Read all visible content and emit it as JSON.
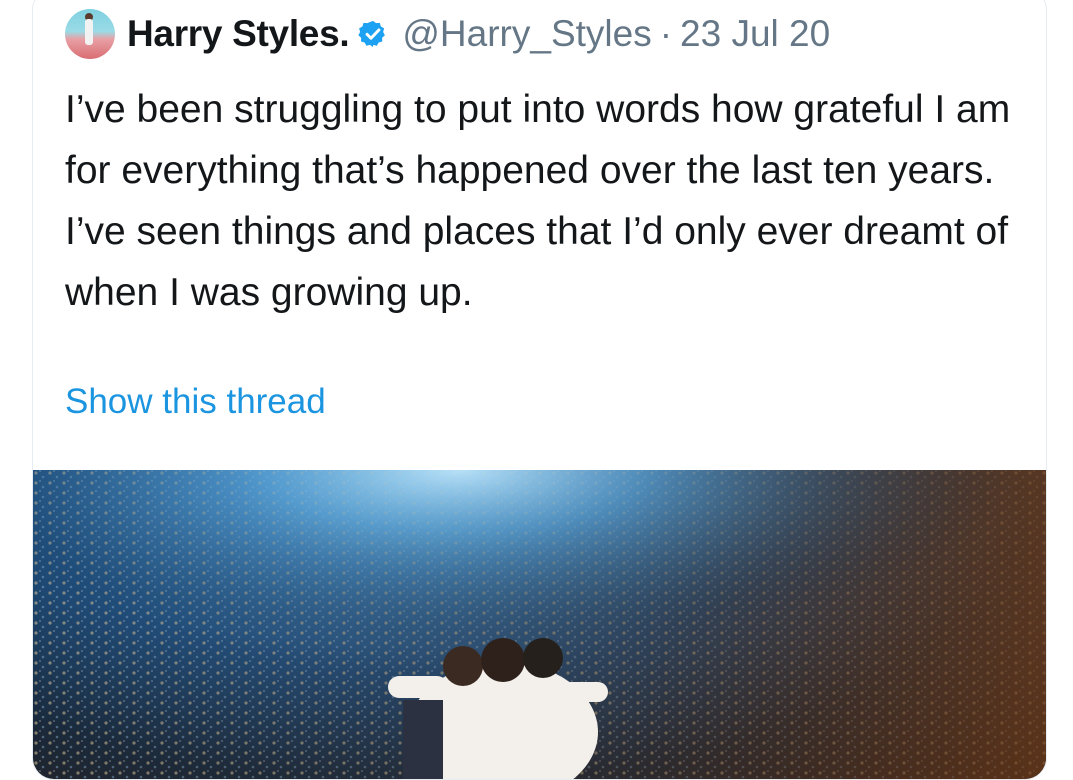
{
  "tweet": {
    "display_name": "Harry Styles.",
    "handle": "@Harry_Styles",
    "separator": "·",
    "date": "23 Jul 20",
    "text": "I’ve been struggling to put into words how grateful I am for everything that’s happened over the last ten years. I’ve seen things and places that I’d only ever dreamt of when I was growing up.",
    "show_thread_label": "Show this thread"
  },
  "icons": {
    "verified": "verified-badge-icon"
  },
  "colors": {
    "name": "#14171a",
    "meta": "#657786",
    "link": "#1b95e0",
    "verified": "#1da1f2"
  }
}
